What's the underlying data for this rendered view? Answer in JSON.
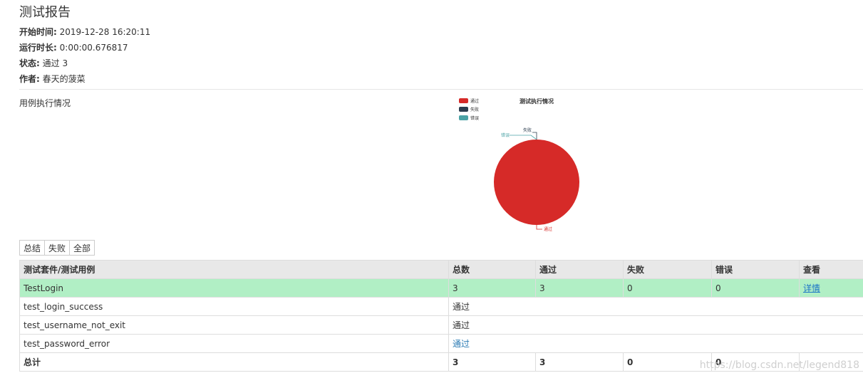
{
  "header": {
    "title": "测试报告",
    "start_label": "开始时间:",
    "start_value": "2019-12-28 16:20:11",
    "duration_label": "运行时长:",
    "duration_value": "0:00:00.676817",
    "status_label": "状态:",
    "status_value": "通过 3",
    "author_label": "作者:",
    "author_value": "春天的菠菜"
  },
  "section_label": "用例执行情况",
  "chart_data": {
    "type": "pie",
    "title": "测试执行情况",
    "categories": [
      "通过",
      "失败",
      "错误"
    ],
    "values": [
      3,
      0,
      0
    ],
    "colors": [
      "#d62a28",
      "#2c3e4f",
      "#4ba3a6"
    ],
    "legend": "top-left"
  },
  "filters": [
    "总结",
    "失败",
    "全部"
  ],
  "table": {
    "headers": [
      "测试套件/测试用例",
      "总数",
      "通过",
      "失败",
      "错误",
      "查看"
    ],
    "suite": {
      "name": "TestLogin",
      "total": "3",
      "pass": "3",
      "fail": "0",
      "error": "0",
      "view": "详情"
    },
    "cases": [
      {
        "name": "test_login_success",
        "status": "通过"
      },
      {
        "name": "test_username_not_exit",
        "status": "通过"
      },
      {
        "name": "test_password_error",
        "status": "通过"
      }
    ],
    "total": {
      "label": "总计",
      "total": "3",
      "pass": "3",
      "fail": "0",
      "error": "0"
    }
  },
  "watermark": "https://blog.csdn.net/legend818"
}
